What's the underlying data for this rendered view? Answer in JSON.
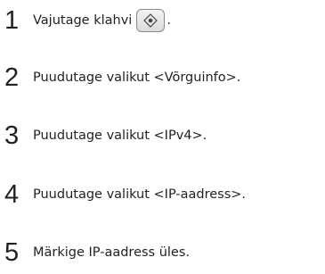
{
  "steps": [
    {
      "number": "1",
      "text": "Vajutage klahvi",
      "key_icon": "settings-key-icon",
      "suffix": "."
    },
    {
      "number": "2",
      "text": "Puudutage valikut <Võrguinfo>."
    },
    {
      "number": "3",
      "text": "Puudutage valikut <IPv4>."
    },
    {
      "number": "4",
      "text": "Puudutage valikut <IP-aadress>."
    },
    {
      "number": "5",
      "text": "Märkige IP-aadress üles."
    }
  ]
}
